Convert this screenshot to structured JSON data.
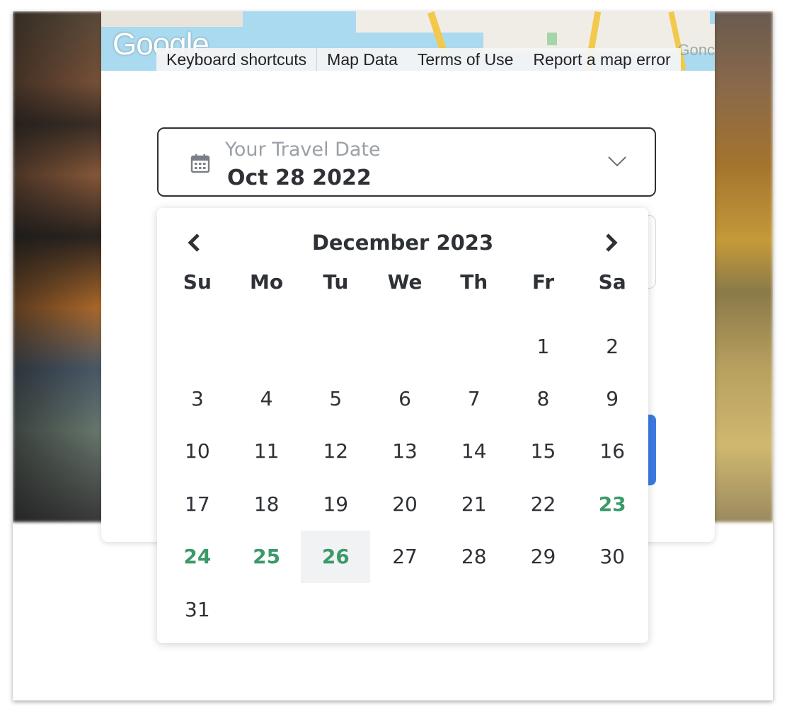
{
  "map": {
    "logo_text": "Google",
    "footer_links": [
      "Keyboard shortcuts",
      "Map Data",
      "Terms of Use",
      "Report a map error"
    ],
    "edge_label": "Gonc"
  },
  "date_field": {
    "label": "Your Travel Date",
    "value": "Oct 28 2022",
    "icon": "calendar-icon",
    "toggle_icon": "chevron-down-icon"
  },
  "calendar": {
    "month_label": "December 2023",
    "prev_icon": "chevron-left-icon",
    "next_icon": "chevron-right-icon",
    "weekdays": [
      "Su",
      "Mo",
      "Tu",
      "We",
      "Th",
      "Fr",
      "Sa"
    ],
    "weeks": [
      [
        "",
        "",
        "",
        "",
        "",
        "1",
        "2"
      ],
      [
        "3",
        "4",
        "5",
        "6",
        "7",
        "8",
        "9"
      ],
      [
        "10",
        "11",
        "12",
        "13",
        "14",
        "15",
        "16"
      ],
      [
        "17",
        "18",
        "19",
        "20",
        "21",
        "22",
        "23"
      ],
      [
        "24",
        "25",
        "26",
        "27",
        "28",
        "29",
        "30"
      ],
      [
        "31",
        "",
        "",
        "",
        "",
        "",
        ""
      ]
    ],
    "highlighted_days": [
      "23",
      "24",
      "25",
      "26"
    ],
    "selected_day": "26",
    "highlight_color": "#3b9a6a"
  },
  "colors": {
    "accent_blue": "#3b7be5",
    "text_dark": "#2e3136",
    "label_gray": "#9aa0a8"
  }
}
